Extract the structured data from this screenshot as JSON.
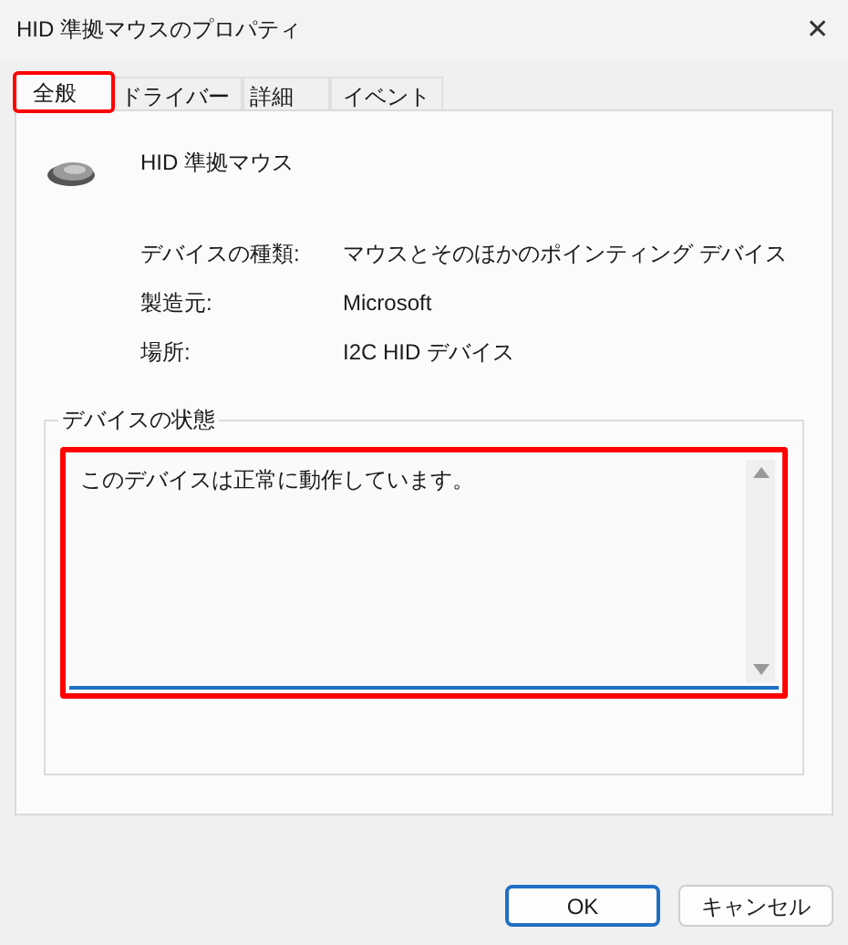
{
  "window": {
    "title": "HID 準拠マウスのプロパティ",
    "close": "✕"
  },
  "tabs": [
    {
      "label": "全般",
      "selected": true,
      "highlighted": true
    },
    {
      "label": "ドライバー",
      "selected": false,
      "highlighted": false
    },
    {
      "label": "詳細",
      "selected": false,
      "highlighted": false
    },
    {
      "label": "イベント",
      "selected": false,
      "highlighted": false
    }
  ],
  "device": {
    "name": "HID 準拠マウス"
  },
  "properties": [
    {
      "label": "デバイスの種類:",
      "value": "マウスとそのほかのポインティング デバイス"
    },
    {
      "label": "製造元:",
      "value": "Microsoft"
    },
    {
      "label": "場所:",
      "value": "I2C HID デバイス"
    }
  ],
  "status": {
    "title": "デバイスの状態",
    "text": "このデバイスは正常に動作しています。",
    "highlighted": true
  },
  "buttons": [
    {
      "label": "OK",
      "default": true
    },
    {
      "label": "キャンセル",
      "default": false
    }
  ]
}
